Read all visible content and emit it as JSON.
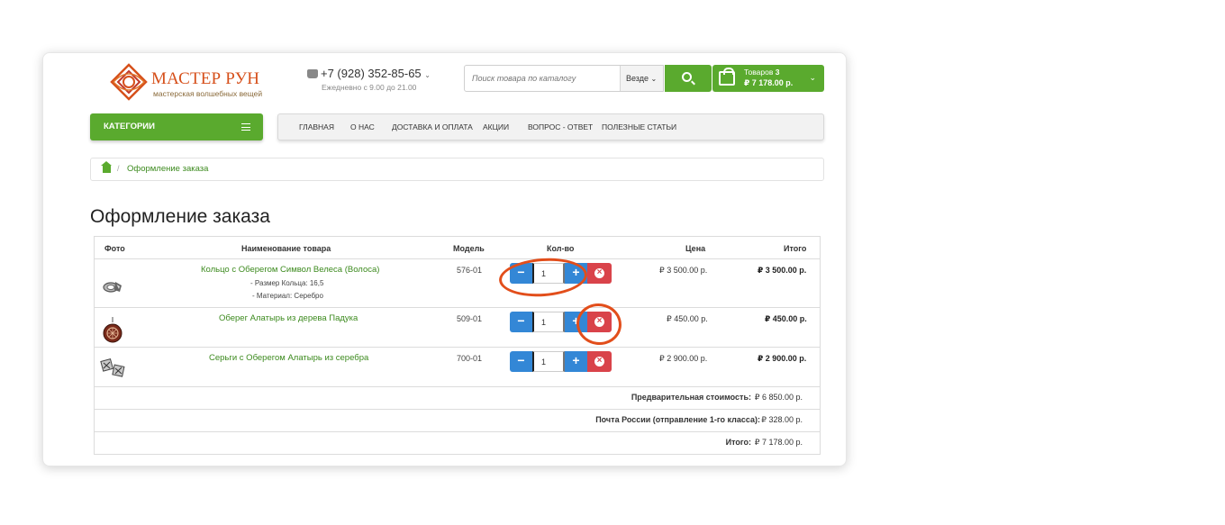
{
  "header": {
    "logo_name": "МАСТЕР РУН",
    "logo_tagline": "мастерская волшебных вещей",
    "phone": "+7 (928) 352-85-65",
    "hours": "Ежедневно с 9.00 до 21.00",
    "search_placeholder": "Поиск товара по каталогу",
    "search_scope": "Везде",
    "cart_items_label": "Товаров",
    "cart_count": "3",
    "cart_total": "₽ 7 178.00 р."
  },
  "nav": {
    "categories_label": "КАТЕГОРИИ",
    "items": [
      "ГЛАВНАЯ",
      "О НАС",
      "ДОСТАВКА И ОПЛАТА",
      "АКЦИИ",
      "ВОПРОС - ОТВЕТ",
      "ПОЛЕЗНЫЕ СТАТЬИ"
    ]
  },
  "breadcrumb": {
    "current": "Оформление заказа"
  },
  "page_title": "Оформление заказа",
  "table": {
    "headers": {
      "photo": "Фото",
      "name": "Наименование товара",
      "model": "Модель",
      "qty": "Кол-во",
      "price": "Цена",
      "total": "Итого"
    },
    "rows": [
      {
        "name": "Кольцо с Оберегом Символ Велеса (Волоса)",
        "options": [
          "- Размер Кольца: 16,5",
          "- Материал: Серебро"
        ],
        "model": "576-01",
        "qty": "1",
        "price": "₽ 3 500.00 р.",
        "total": "₽ 3 500.00 р."
      },
      {
        "name": "Оберег Алатырь из дерева Падука",
        "options": [],
        "model": "509-01",
        "qty": "1",
        "price": "₽ 450.00 р.",
        "total": "₽ 450.00 р."
      },
      {
        "name": "Серьги с Оберегом Алатырь из серебра",
        "options": [],
        "model": "700-01",
        "qty": "1",
        "price": "₽ 2 900.00 р.",
        "total": "₽ 2 900.00 р."
      }
    ],
    "summary": [
      {
        "label": "Предварительная стоимость:",
        "value": "₽ 6 850.00 р."
      },
      {
        "label": "Почта России (отправление 1-го класса):",
        "value": "₽ 328.00 р."
      },
      {
        "label": "Итого:",
        "value": "₽ 7 178.00 р."
      }
    ]
  },
  "colors": {
    "brand_green": "#5aaa2e",
    "link_green": "#3c8a1e",
    "qty_blue": "#3387d6",
    "delete_red": "#d9434a",
    "annotation_orange": "#e24e1b",
    "logo_orange": "#d6501b"
  }
}
